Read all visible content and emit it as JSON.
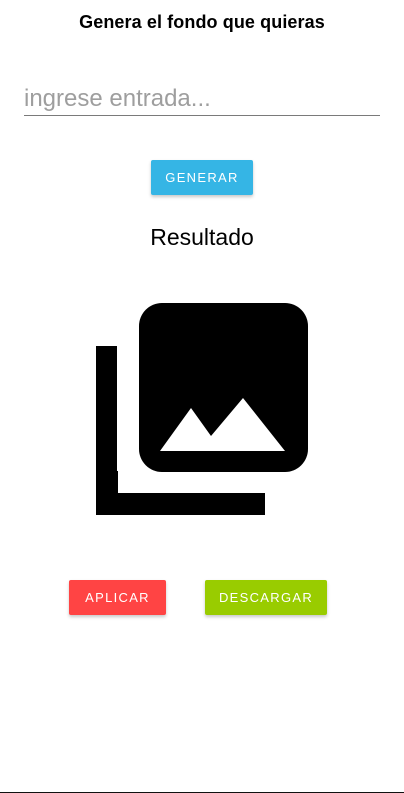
{
  "header": {
    "title": "Genera el fondo que quieras"
  },
  "form": {
    "input_placeholder": "ingrese entrada...",
    "input_value": "",
    "generate_label": "GENERAR"
  },
  "result": {
    "title": "Resultado",
    "image_icon": "image-collection-icon"
  },
  "actions": {
    "apply_label": "APLICAR",
    "download_label": "DESCARGAR"
  },
  "colors": {
    "generate_button": "#35b5e5",
    "apply_button": "#ff4444",
    "download_button": "#99cc00"
  }
}
